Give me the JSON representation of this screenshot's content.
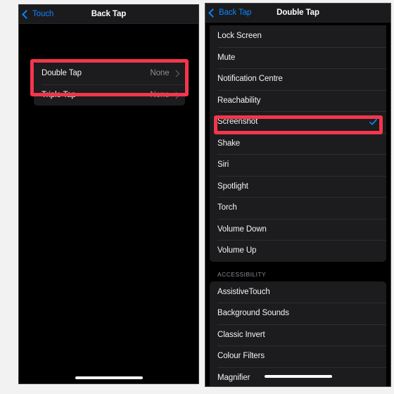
{
  "theme": {
    "accent_blue": "#0a84ff",
    "annotation_red": "#f4364c",
    "list_background": "#1c1c1e",
    "screen_background": "#000000",
    "primary_text": "#f4f4f6",
    "secondary_text": "#8e8e93"
  },
  "left_screen": {
    "navbar": {
      "back_label": "Touch",
      "title": "Back Tap",
      "back_icon": "chevron-left-icon"
    },
    "rows": [
      {
        "label": "Double Tap",
        "value": "None",
        "accessory": "chevron-right-icon"
      },
      {
        "label": "Triple Tap",
        "value": "None",
        "accessory": "chevron-right-icon"
      }
    ],
    "home_indicator": "home-indicator"
  },
  "right_screen": {
    "navbar": {
      "back_label": "Back Tap",
      "title": "Double Tap",
      "back_icon": "chevron-left-icon"
    },
    "system_actions": [
      {
        "label": "Lock Screen",
        "selected": false
      },
      {
        "label": "Mute",
        "selected": false
      },
      {
        "label": "Notification Centre",
        "selected": false
      },
      {
        "label": "Reachability",
        "selected": false
      },
      {
        "label": "Screenshot",
        "selected": true
      },
      {
        "label": "Shake",
        "selected": false
      },
      {
        "label": "Siri",
        "selected": false
      },
      {
        "label": "Spotlight",
        "selected": false
      },
      {
        "label": "Torch",
        "selected": false
      },
      {
        "label": "Volume Down",
        "selected": false
      },
      {
        "label": "Volume Up",
        "selected": false
      }
    ],
    "accessibility_header": "ACCESSIBILITY",
    "accessibility_actions": [
      {
        "label": "AssistiveTouch",
        "selected": false
      },
      {
        "label": "Background Sounds",
        "selected": false
      },
      {
        "label": "Classic Invert",
        "selected": false
      },
      {
        "label": "Colour Filters",
        "selected": false
      },
      {
        "label": "Magnifier",
        "selected": false
      }
    ],
    "home_indicator": "home-indicator"
  }
}
